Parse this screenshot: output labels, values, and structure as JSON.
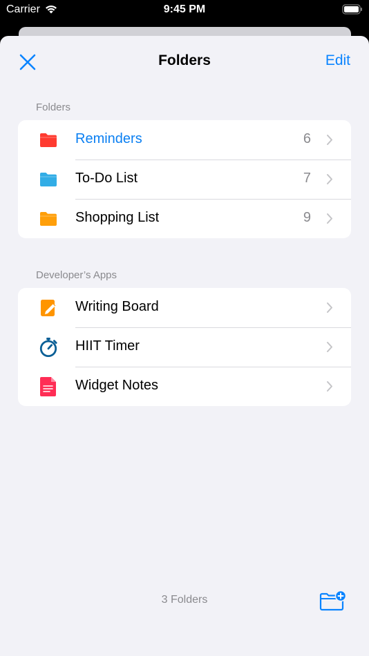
{
  "status_bar": {
    "carrier": "Carrier",
    "time": "9:45 PM"
  },
  "nav": {
    "title": "Folders",
    "edit_label": "Edit"
  },
  "sections": [
    {
      "header": "Folders",
      "rows": [
        {
          "label": "Reminders",
          "count": "6",
          "icon": "folder-icon",
          "icon_color": "#ff3b30",
          "selected": true
        },
        {
          "label": "To-Do List",
          "count": "7",
          "icon": "folder-icon",
          "icon_color": "#32ade6"
        },
        {
          "label": "Shopping List",
          "count": "9",
          "icon": "folder-icon",
          "icon_color": "#ff9f0a"
        }
      ]
    },
    {
      "header": "Developer’s Apps",
      "rows": [
        {
          "label": "Writing Board",
          "icon": "writing-board-icon",
          "icon_color": "#ff9500"
        },
        {
          "label": "HIIT Timer",
          "icon": "stopwatch-icon",
          "icon_color": "#0a5f96"
        },
        {
          "label": "Widget Notes",
          "icon": "note-icon",
          "icon_color": "#ff2d55"
        }
      ]
    }
  ],
  "footer": {
    "count_label": "3 Folders"
  },
  "colors": {
    "accent": "#0a84ff",
    "background": "#f2f2f7"
  }
}
